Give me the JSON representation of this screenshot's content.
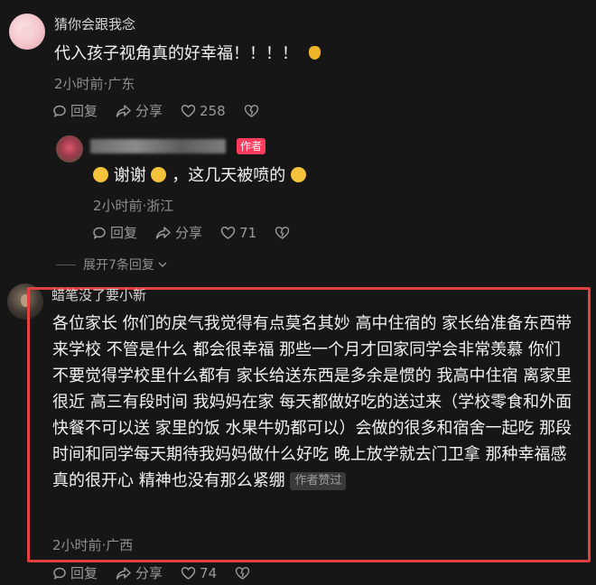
{
  "comment1": {
    "username": "猜你会跟我念",
    "text": "代入孩子视角真的好幸福！！！！",
    "meta": "2小时前·广东",
    "reply_label": "回复",
    "share_label": "分享",
    "like_count": "258"
  },
  "reply1": {
    "author_badge": "作者",
    "text_part1": "谢谢",
    "text_part2": "，这几天被喷的",
    "meta": "2小时前·浙江",
    "reply_label": "回复",
    "share_label": "分享",
    "like_count": "71"
  },
  "expand_label": "展开7条回复",
  "comment2": {
    "username": "蜡笔没了要小新",
    "text": "各位家长 你们的戾气我觉得有点莫名其妙 高中住宿的 家长给准备东西带来学校 不管是什么 都会很幸福 那些一个月才回家同学会非常羡慕 你们不要觉得学校里什么都有 家长给送东西是多余是惯的 我高中住宿 离家里很近 高三有段时间 我妈妈在家 每天都做好吃的送过来（学校零食和外面快餐不可以送 家里的饭 水果牛奶都可以）会做的很多和宿舍一起吃 那段时间和同学每天期待我妈妈做什么好吃 晚上放学就去门卫拿 那种幸福感真的很开心 精神也没有那么紧绷",
    "liked_tag": "作者赞过",
    "meta": "2小时前·广西",
    "reply_label": "回复",
    "share_label": "分享",
    "like_count": "74"
  },
  "colors": {
    "background": "#161616",
    "highlight_border": "#e0403f",
    "author_badge": "#ff3b5c"
  }
}
